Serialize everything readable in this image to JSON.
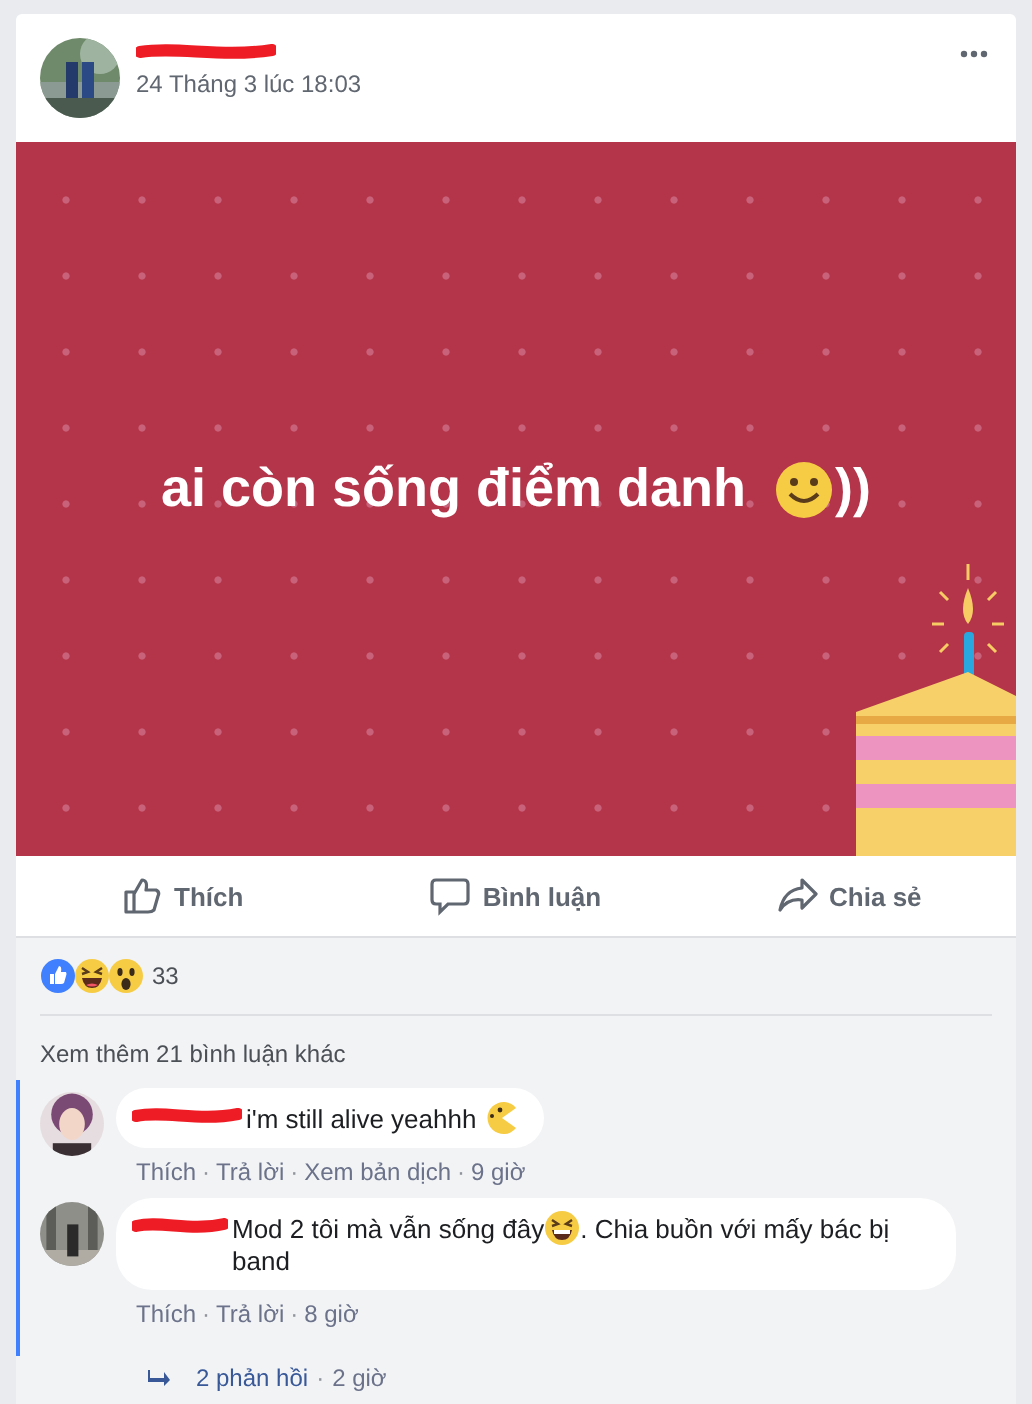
{
  "post": {
    "author_redacted": true,
    "timestamp": "24 Tháng 3 lúc 18:03",
    "banner": {
      "text_before": "ai còn sống điểm danh",
      "text_after": "))"
    }
  },
  "actions": [
    {
      "kind": "like",
      "label": "Thích"
    },
    {
      "kind": "comment",
      "label": "Bình luận"
    },
    {
      "kind": "share",
      "label": "Chia sẻ"
    }
  ],
  "reactions": {
    "types": [
      {
        "kind": "like"
      },
      {
        "kind": "haha"
      },
      {
        "kind": "wow"
      }
    ],
    "count": "33"
  },
  "separator": "·",
  "more_comments": "Xem thêm 21 bình luận khác",
  "comments": [
    {
      "segments": [
        {
          "kind": "text",
          "text": "i'm still alive yeahhh "
        },
        {
          "kind": "pacman"
        }
      ],
      "actions": [
        "Thích",
        "Trả lời",
        "Xem bản dịch",
        "9 giờ"
      ]
    },
    {
      "segments": [
        {
          "kind": "text",
          "text": "Mod 2 tôi mà vẫn sống đây"
        },
        {
          "kind": "grin"
        },
        {
          "kind": "text",
          "text": ". Chia buồn với mấy bác bị band"
        }
      ],
      "actions": [
        "Thích",
        "Trả lời",
        "8 giờ"
      ]
    }
  ],
  "replies": {
    "count": "2 phản hồi",
    "time": "2 giờ"
  }
}
